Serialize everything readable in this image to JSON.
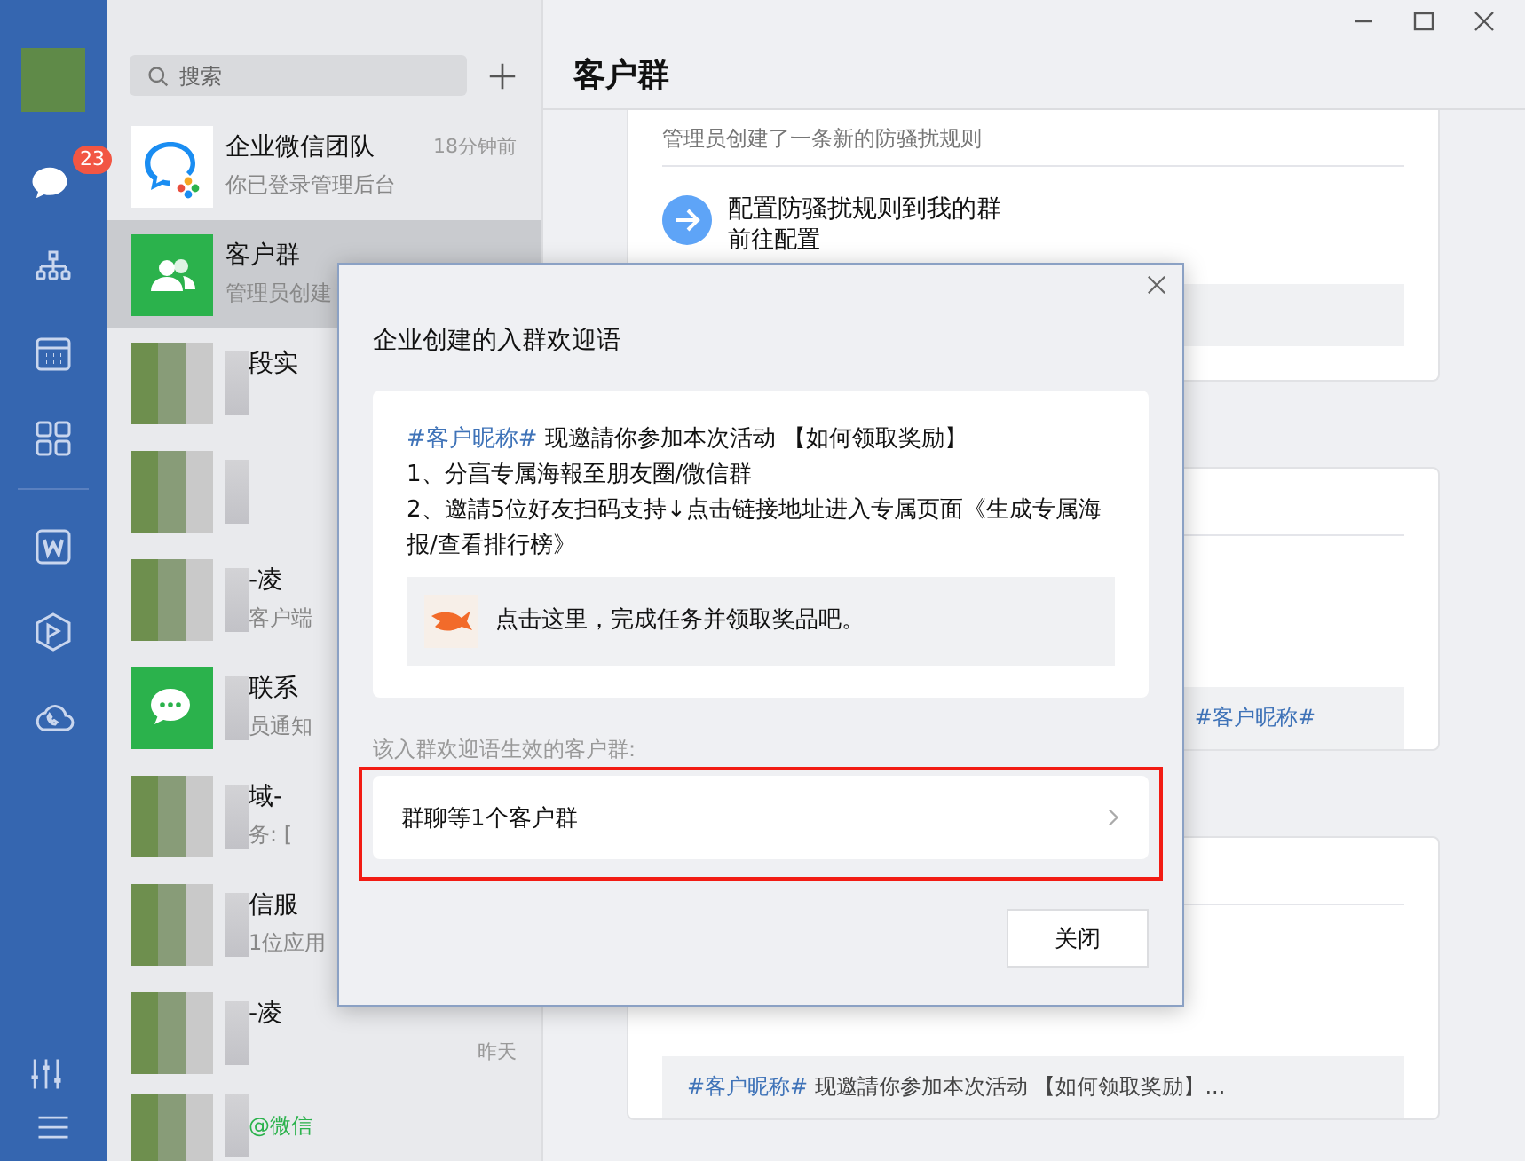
{
  "sidebar": {
    "items": [
      {
        "kind": "chat",
        "badge": "23"
      },
      {
        "kind": "org"
      },
      {
        "kind": "calendar"
      },
      {
        "kind": "apps"
      },
      {
        "kind": "divider"
      },
      {
        "kind": "doc"
      },
      {
        "kind": "hexagon"
      },
      {
        "kind": "cloud"
      }
    ],
    "bottom": [
      {
        "kind": "sliders"
      },
      {
        "kind": "menu"
      }
    ]
  },
  "chat_list": {
    "search": {
      "placeholder": "搜索"
    },
    "items": [
      {
        "kind": "logo",
        "name": "企业微信团队",
        "preview": "你已登录管理后台",
        "time": "18分钟前",
        "selected": false
      },
      {
        "kind": "group",
        "name": "客户群",
        "preview": "管理员创建",
        "selected": true
      },
      {
        "kind": "photo",
        "name": "段实",
        "selected": false
      },
      {
        "kind": "photo",
        "selected": false
      },
      {
        "kind": "photo",
        "name": "-凌",
        "preview": "客户端",
        "selected": false
      },
      {
        "kind": "chat",
        "name": "联系",
        "preview": "员通知",
        "selected": false
      },
      {
        "kind": "photo",
        "name": "域-",
        "preview": "务: [",
        "selected": false
      },
      {
        "kind": "photo",
        "name": "信服",
        "preview": "1位应用",
        "selected": false
      },
      {
        "kind": "photo",
        "name": "-凌",
        "time": "昨天",
        "selected": false
      },
      {
        "kind": "photo",
        "preview": "@微信",
        "selected": false
      }
    ]
  },
  "main": {
    "title": "客户群",
    "cards": [
      {
        "kind": "rule",
        "note": "管理员创建了一条新的防骚扰规则",
        "action": "配置防骚扰规则到我的群",
        "link": "前往配置"
      },
      {
        "kind": "message",
        "quote_tag": "#客户昵称#"
      },
      {
        "kind": "message",
        "quote_tag": "#客户昵称#",
        "quote": " 现邀請你参加本次活动 【如何领取奖励】..."
      }
    ]
  },
  "dialog": {
    "title": "企业创建的入群欢迎语",
    "message": {
      "tag": "#客户昵称#",
      "text": " 现邀請你参加本次活动 【如何领取奖励】",
      "lines": [
        " 1、分亯专属海報至朋友圈/微信群",
        "2、邀請5位好友扫码支持↓点击链接地址进入专属页面《生成专属海报/查看排行榜》"
      ],
      "link_card": "点击这里，完成任务并领取奖品吧。"
    },
    "groups_label": "该入群欢迎语生效的客户群:",
    "group_row": "群聊等1个客户群",
    "highlighted": true,
    "button": "关闭"
  }
}
